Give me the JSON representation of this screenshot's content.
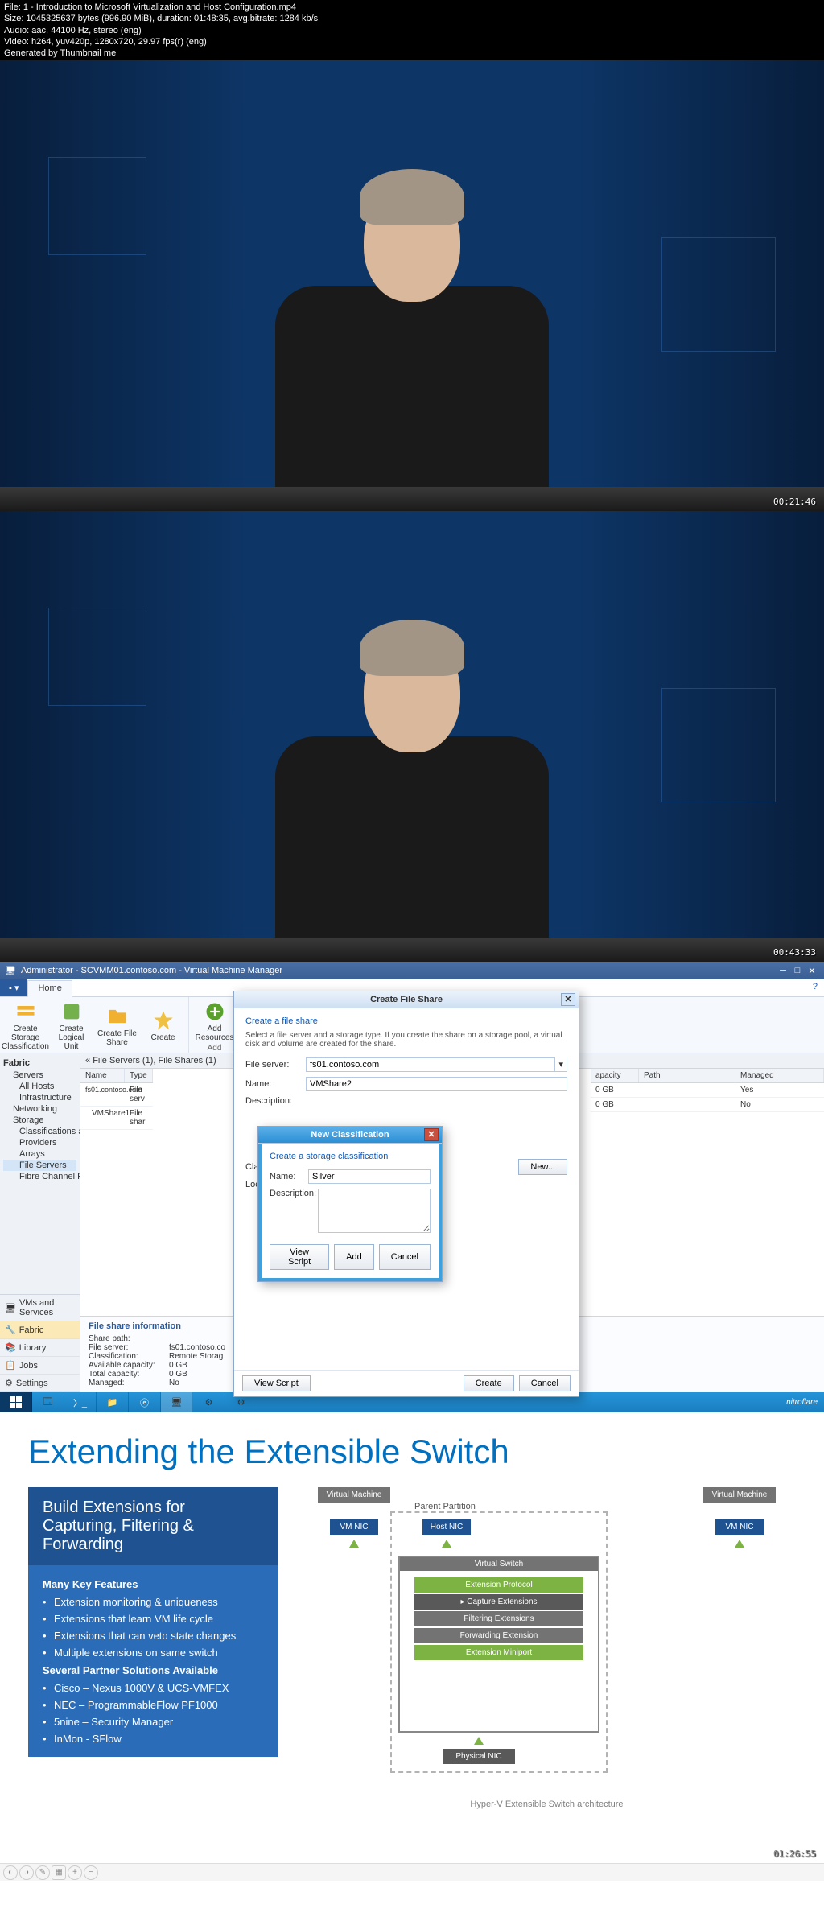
{
  "meta": {
    "file": "File: 1 - Introduction to Microsoft Virtualization and Host Configuration.mp4",
    "size": "Size: 1045325637 bytes (996.90 MiB), duration: 01:48:35, avg.bitrate: 1284 kb/s",
    "audio": "Audio: aac, 44100 Hz, stereo (eng)",
    "video": "Video: h264, yuv420p, 1280x720, 29.97 fps(r) (eng)",
    "gen": "Generated by Thumbnail me"
  },
  "frames": {
    "ts1": "00:21:46",
    "ts2": "00:43:33",
    "ts3": "",
    "ts4": "01:26:55"
  },
  "vmm": {
    "title": "Administrator - SCVMM01.contoso.com - Virtual Machine Manager",
    "tabs": {
      "file": "",
      "home": "Home"
    },
    "ribbon": {
      "btns": [
        "Create Storage Classification",
        "Create Logical Unit",
        "Create File Share",
        "Create",
        "Add Resources"
      ],
      "groups": [
        "Create",
        "Add"
      ]
    },
    "nav": {
      "hdr": "Fabric",
      "tree": [
        "Servers",
        "All Hosts",
        "Infrastructure",
        "Networking",
        "Storage",
        "Classifications and Poo",
        "Providers",
        "Arrays",
        "File Servers",
        "Fibre Channel Fabrics"
      ],
      "wunder": [
        "VMs and Services",
        "Fabric",
        "Library",
        "Jobs",
        "Settings"
      ]
    },
    "breadcrumb": "File Servers (1), File Shares (1)",
    "grid": {
      "cols": [
        "Name",
        "Type"
      ],
      "cols2": [
        "apacity",
        "Path",
        "Managed"
      ],
      "rows": [
        {
          "name": "fs01.contoso.com",
          "type": "File serv"
        },
        {
          "name": "VMShare1",
          "type": "File shar"
        }
      ],
      "rows2": [
        {
          "cap": "0 GB",
          "path": "",
          "man": "Yes"
        },
        {
          "cap": "0 GB",
          "path": "",
          "man": "No"
        }
      ]
    },
    "info": {
      "title": "File share information",
      "kv": [
        {
          "k": "Share path:",
          "v": ""
        },
        {
          "k": "File server:",
          "v": "fs01.contoso.co"
        },
        {
          "k": "Classification:",
          "v": "Remote Storag"
        },
        {
          "k": "Available capacity:",
          "v": "0 GB"
        },
        {
          "k": "Total capacity:",
          "v": "0 GB"
        },
        {
          "k": "Managed:",
          "v": "No"
        }
      ]
    },
    "wizard": {
      "title": "Create File Share",
      "hdr": "Create a file share",
      "desc": "Select a file server and a storage type. If you create the share on a storage pool, a virtual disk and volume are created for the share.",
      "fields": {
        "fileserver_lbl": "File server:",
        "fileserver_val": "fs01.contoso.com",
        "name_lbl": "Name:",
        "name_val": "VMShare2",
        "desc_lbl": "Description:",
        "class_lbl": "Classification:",
        "local_lbl": "Local path:",
        "new_btn": "New..."
      },
      "btns": {
        "script": "View Script",
        "create": "Create",
        "cancel": "Cancel"
      }
    },
    "inner": {
      "title": "New Classification",
      "hdr": "Create a storage classification",
      "name_lbl": "Name:",
      "name_val": "Silver",
      "desc_lbl": "Description:",
      "btns": {
        "script": "View Script",
        "add": "Add",
        "cancel": "Cancel"
      }
    },
    "tray": "nitroflare"
  },
  "slide": {
    "title": "Extending the Extensible Switch",
    "box_hdr": "Build Extensions for Capturing, Filtering & Forwarding",
    "sect1": "Many Key Features",
    "items1": [
      "Extension monitoring & uniqueness",
      "Extensions that learn VM life cycle",
      "Extensions that can veto state changes",
      "Multiple extensions on same switch"
    ],
    "sect2": "Several Partner Solutions Available",
    "items2": [
      "Cisco – Nexus 1000V & UCS-VMFEX",
      "NEC – ProgrammableFlow PF1000",
      "5nine – Security Manager",
      "InMon - SFlow"
    ],
    "arch": {
      "vm1": "Virtual Machine",
      "vm2": "Virtual Machine",
      "nic1": "VM NIC",
      "nic2": "VM NIC",
      "hostnic": "Host NIC",
      "parent": "Parent Partition",
      "vswitch": "Virtual Switch",
      "layers": [
        "Extension Protocol",
        "Capture Extensions",
        "Filtering Extensions",
        "Forwarding Extension",
        "Extension Miniport"
      ],
      "phys": "Physical NIC",
      "caption": "Hyper-V Extensible Switch architecture"
    }
  }
}
